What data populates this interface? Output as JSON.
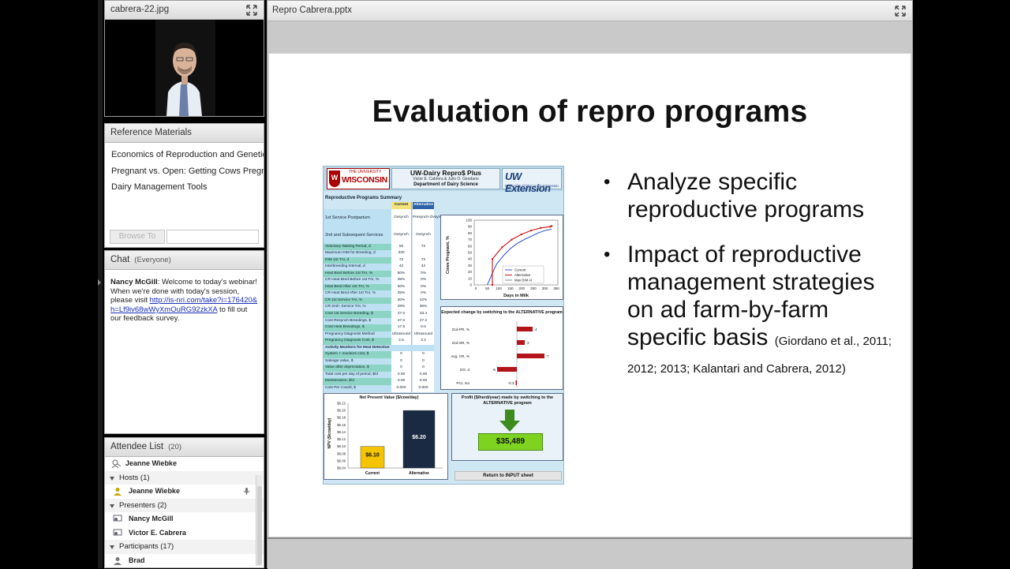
{
  "video_pod": {
    "title": "cabrera-22.jpg"
  },
  "reference": {
    "title": "Reference Materials",
    "items": [
      "Economics of Reproduction and Genetics",
      "Pregnant vs. Open: Getting Cows Pregnant",
      "Dairy Management Tools"
    ],
    "browse_label": "Browse To"
  },
  "chat": {
    "title": "Chat",
    "scope": "(Everyone)",
    "message": {
      "sender": "Nancy McGill",
      "text_before": ": Welcome to today's webinar! When we're done with today's session, please visit ",
      "link": "http://is-nri.com/take?i=176420&h=Lf9iv68wWyXmOuRG92zkXA",
      "text_after": " to fill out our feedback survey."
    }
  },
  "attendees": {
    "title": "Attendee List",
    "count": "(20)",
    "top_user": "Jeanne Wiebke",
    "hosts_label": "Hosts (1)",
    "hosts": [
      "Jeanne Wiebke"
    ],
    "presenters_label": "Presenters (2)",
    "presenters": [
      "Nancy McGill",
      "Victor E. Cabrera"
    ],
    "participants_label": "Participants (17)",
    "participants": [
      "Brad"
    ]
  },
  "share": {
    "title": "Repro Cabrera.pptx",
    "slide_title": "Evaluation of repro programs",
    "bullet1": "Analyze specific reproductive programs",
    "bullet2": "Impact of reproductive management strategies on ad farm-by-farm specific basis",
    "citation": "(Giordano et al., 2011; 2012; 2013; Kalantari and Cabrera, 2012)"
  },
  "sheet": {
    "uw_small": "THE UNIVERSITY",
    "uw_name": "WISCONSIN",
    "uw_shield": "W",
    "title": "UW-Dairy Repro$ Plus",
    "authors": "Victor E. Cabrera & Julio O. Giordano",
    "dept": "Department of Dairy Science",
    "ext_name": "UW Extension",
    "ext_sub": "University of Wisconsin-Extension",
    "summary": "Reproductive Programs Summary",
    "col_current": "Current",
    "col_alternative": "Alternative",
    "rows": [
      {
        "label": "1st Service Postpartum",
        "current": "Ovsynch",
        "alternative": "Presynch-Ovsynch-12"
      },
      {
        "label": "2nd and Subsequent Services",
        "current": "Ovsynch",
        "alternative": "Ovsynch"
      },
      {
        "label": "Voluntary Waiting Period, d",
        "current": "50",
        "alternative": "72"
      },
      {
        "label": "Maximum DIM for Breeding, d",
        "current": "330",
        "alternative": ""
      },
      {
        "label": "DIM 1st TAI, d",
        "current": "72",
        "alternative": "72"
      },
      {
        "label": "Interbreeding Interval, d",
        "current": "42",
        "alternative": "42"
      },
      {
        "label": "Heat Bred Before 1st TAI, %",
        "current": "80%",
        "alternative": "0%"
      },
      {
        "label": "CR Heat Bred Before 1st TAI, %",
        "current": "35%",
        "alternative": "0%"
      },
      {
        "label": "Heat Bred After 1st TAI, %",
        "current": "50%",
        "alternative": "0%"
      },
      {
        "label": "CR Heat Bred After 1st TAI, %",
        "current": "35%",
        "alternative": "0%"
      },
      {
        "label": "CR 1st Service TAI, %",
        "current": "30%",
        "alternative": "42%"
      },
      {
        "label": "CR 2nd+ Service TAI, %",
        "current": "28%",
        "alternative": "35%"
      },
      {
        "label": "Cost 1st Service Breeding, $",
        "current": "27.0",
        "alternative": "33.4"
      },
      {
        "label": "Cost Resynch Breedings, $",
        "current": "27.0",
        "alternative": "27.2"
      },
      {
        "label": "Cost Heat Breedings, $",
        "current": "17.6",
        "alternative": "0.0"
      },
      {
        "label": "Pregnancy Diagnosis Method",
        "current": "Ultrasound",
        "alternative": "Ultrasound"
      },
      {
        "label": "Pregnancy Diagnosis Cost, $",
        "current": "2.6",
        "alternative": "3.4"
      }
    ],
    "monitors_label": "Activity Monitors for Heat Detection",
    "monitor_rows": [
      {
        "label": "System + monitors cost, $",
        "current": "0",
        "alternative": "0"
      },
      {
        "label": "Salvage value, $",
        "current": "0",
        "alternative": "0"
      },
      {
        "label": "Value after depreciation, $",
        "current": "0",
        "alternative": "0"
      },
      {
        "label": "Total cost per day of period, $/d",
        "current": "0.00",
        "alternative": "0.00"
      },
      {
        "label": "Maintenance, $/d",
        "current": "0.00",
        "alternative": "0.00"
      },
      {
        "label": "Cost Per Cow/d, $",
        "current": "0.000",
        "alternative": "0.000"
      }
    ],
    "preg_chart": {
      "ylabel": "Cows Pregnant, %",
      "xlabel": "Days in Milk",
      "legend": [
        "Current",
        "Alternative",
        "Max DIM AI"
      ],
      "y_ticks": [
        "100",
        "90",
        "80",
        "70",
        "60",
        "50",
        "40",
        "30",
        "20",
        "10",
        "0"
      ],
      "x_ticks": [
        "0",
        "50",
        "100",
        "150",
        "200",
        "250",
        "300",
        "350"
      ]
    },
    "change_chart": {
      "title": "Expected change by switching to the ALTERNATIVE program",
      "rows": [
        {
          "label": "21d-PR, %",
          "value": "4"
        },
        {
          "label": "21d-SR, %",
          "value": "2"
        },
        {
          "label": "Avg. CR, %",
          "value": "7"
        },
        {
          "label": "DO, d",
          "value": "-5"
        },
        {
          "label": "PCI, mo",
          "value": "-0.3"
        }
      ]
    },
    "npv_chart": {
      "title": "Net Present Value ($/cow/day)",
      "ylabel": "NPV ($/cow/day)",
      "y_ticks": [
        "$6.22",
        "$6.20",
        "$6.18",
        "$6.16",
        "$6.14",
        "$6.12",
        "$6.10",
        "$6.08",
        "$6.06",
        "$6.04"
      ],
      "current_label": "$6.10",
      "alternative_label": "$6.20",
      "x_current": "Current",
      "x_alternative": "Alternative"
    },
    "profit": {
      "title": "Profit ($/herd/year) made by switching to the ALTERNATIVE program",
      "value": "$35,489"
    },
    "return_btn": "Return to INPUT sheet"
  }
}
